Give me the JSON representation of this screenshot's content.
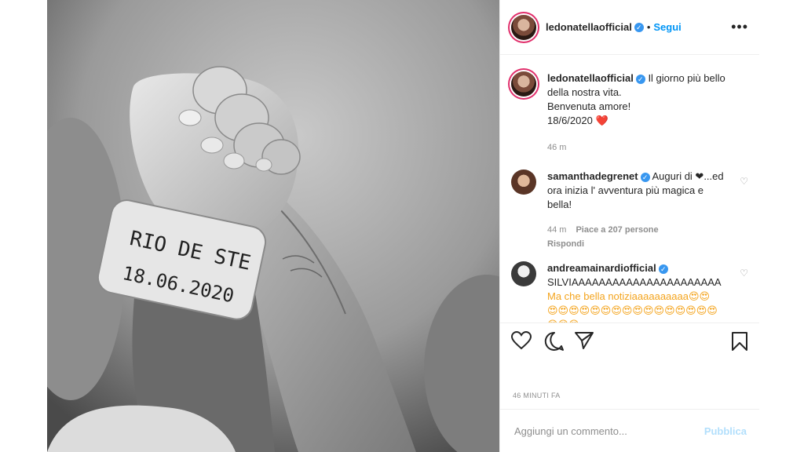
{
  "post": {
    "image_alt": "Black and white photo of a newborn's hand gripping an adult finger, wearing a hospital wristband",
    "wristband_text_1": "RIO DE STE",
    "wristband_text_2": "18.06.2020"
  },
  "header": {
    "username": "ledonatellaofficial",
    "dot": "•",
    "follow_label": "Segui",
    "more_label": "•••"
  },
  "caption": {
    "username": "ledonatellaofficial",
    "line1": "Il giorno più bello della nostra vita.",
    "line2": "Benvenuta amore!",
    "line3": "18/6/2020 ❤️",
    "time": "46 m"
  },
  "comments": [
    {
      "username": "samanthadegrenet",
      "text": "Auguri di ❤...ed ora inizia l' avventura più magica e bella!",
      "time": "44 m",
      "likes": "Piace a 207 persone",
      "reply": "Rispondi"
    },
    {
      "username": "andreamainardiofficial",
      "text1": "SILVIAAAAAAAAAAAAAAAAAAAAAA",
      "text2": "Ma che bella notiziaaaaaaaaaa😍😍",
      "text3": "😍😍😍😍😍😍😍😍😍😍😍😍😍😍😍😍😍😍😍"
    }
  ],
  "footer": {
    "time_ago": "46 MINUTI FA",
    "comment_placeholder": "Aggiungi un commento...",
    "publish_label": "Pubblica"
  },
  "colors": {
    "link": "#0095f6",
    "verified": "#3897f0",
    "publish_disabled": "#b2dffc",
    "heart": "#ed4956"
  }
}
